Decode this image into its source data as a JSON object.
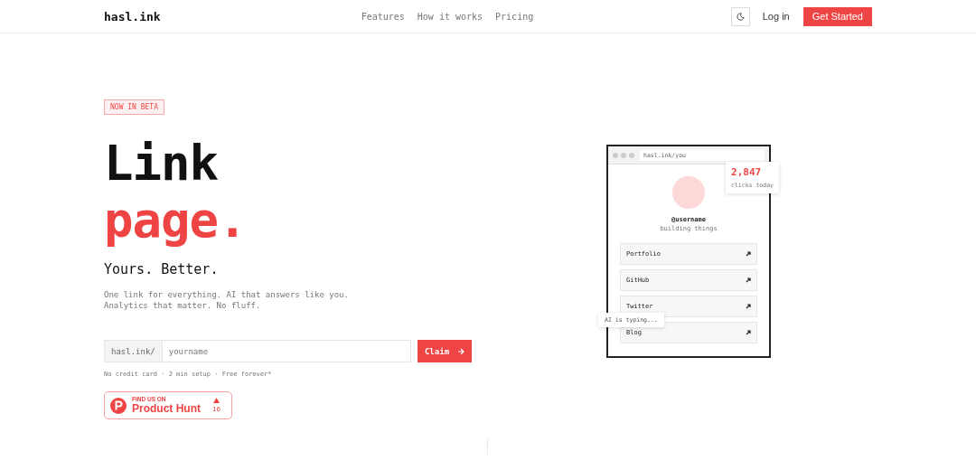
{
  "nav": {
    "logo": "hasl.ink",
    "links": [
      "Features",
      "How it works",
      "Pricing"
    ],
    "login": "Log in",
    "cta": "Get Started"
  },
  "hero": {
    "badge": "NOW IN BETA",
    "title_line1": "Link",
    "title_line2": "page.",
    "subtitle": "Yours. Better.",
    "description": "One link for everything. AI that answers like you.\nAnalytics that matter. No fluff.",
    "prefix": "hasl.ink/",
    "placeholder": "yourname",
    "claim": "Claim",
    "note": "No credit card · 2 min setup · Free forever*"
  },
  "product_hunt": {
    "kicker": "FIND US ON",
    "name": "Product Hunt",
    "count": "16"
  },
  "preview": {
    "url": "hasl.ink/you",
    "username": "@username",
    "bio": "building things",
    "links": [
      "Portfolio",
      "GitHub",
      "Twitter",
      "Blog"
    ],
    "stat_value": "2,847",
    "stat_label": "clicks today",
    "typing": "AI is typing..."
  }
}
